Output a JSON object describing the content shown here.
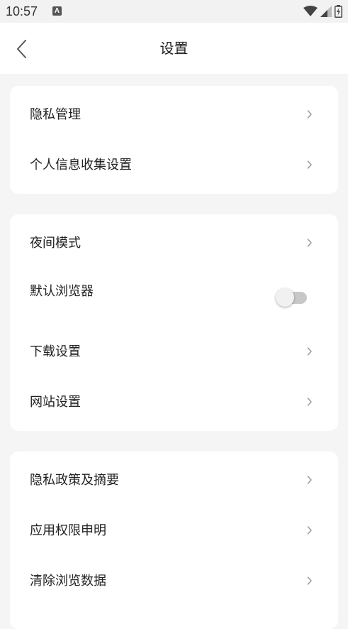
{
  "status_bar": {
    "time": "10:57",
    "notification_icon": "A",
    "icons": [
      "wifi-icon",
      "signal-icon",
      "battery-charging-icon"
    ]
  },
  "header": {
    "title": "设置",
    "back_icon": "chevron-left-icon"
  },
  "groups": [
    {
      "items": [
        {
          "label": "隐私管理",
          "control": "chevron"
        },
        {
          "label": "个人信息收集设置",
          "control": "chevron"
        }
      ]
    },
    {
      "items": [
        {
          "label": "夜间模式",
          "control": "chevron"
        },
        {
          "label": "默认浏览器",
          "control": "toggle",
          "toggle_on": false
        },
        {
          "label": "下载设置",
          "control": "chevron"
        },
        {
          "label": "网站设置",
          "control": "chevron"
        }
      ]
    },
    {
      "items": [
        {
          "label": "隐私政策及摘要",
          "control": "chevron"
        },
        {
          "label": "应用权限申明",
          "control": "chevron"
        },
        {
          "label": "清除浏览数据",
          "control": "chevron"
        }
      ]
    }
  ],
  "colors": {
    "background": "#f5f5f5",
    "card": "#ffffff",
    "text": "#222222",
    "chevron": "#9a9a9a",
    "toggle_track_off": "#c8c8c8"
  }
}
